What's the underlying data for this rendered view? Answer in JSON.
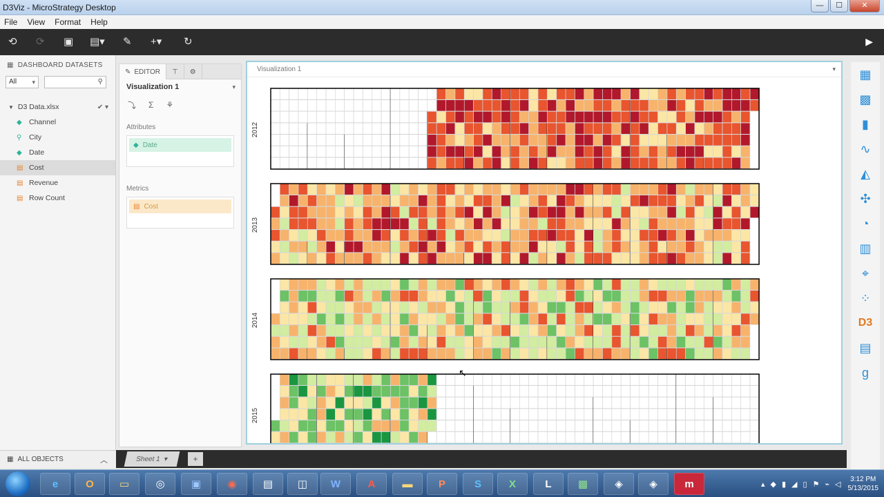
{
  "window": {
    "title": "D3Viz - MicroStrategy Desktop",
    "minimize": "—",
    "maximize": "☐",
    "close": "✕"
  },
  "menu": [
    "File",
    "View",
    "Format",
    "Help"
  ],
  "datasets_panel": {
    "header": "DASHBOARD DATASETS",
    "filter_value": "All",
    "search_placeholder": "",
    "dataset_name": "D3 Data.xlsx",
    "attributes": [
      "Channel",
      "City",
      "Date"
    ],
    "metrics": [
      "Cost",
      "Revenue",
      "Row Count"
    ],
    "selected_item": "Cost",
    "footer": "ALL OBJECTS"
  },
  "editor_panel": {
    "tab_editor": "EDITOR",
    "viz_name": "Visualization 1",
    "attributes_label": "Attributes",
    "attribute_chip": "Date",
    "metrics_label": "Metrics",
    "metric_chip": "Cost"
  },
  "viz_panel": {
    "title": "Visualization 1"
  },
  "sheets": {
    "tab": "Sheet 1",
    "add": "+"
  },
  "taskbar": {
    "time": "3:12 PM",
    "date": "5/13/2015"
  },
  "chart_data": {
    "type": "heatmap",
    "subtype": "calendar",
    "years": [
      "2012",
      "2013",
      "2014",
      "2015"
    ],
    "grid": true,
    "colors": {
      "high": "#b2182b",
      "mid_high": "#e8552f",
      "mid": "#f7b36b",
      "neutral": "#fbe6a5",
      "mid_low": "#d2eca0",
      "low": "#6cc265",
      "lowest": "#1a9641",
      "empty": "#ffffff"
    },
    "year_intensity": {
      "2012": {
        "data_from_month": 5,
        "level": "high"
      },
      "2013": {
        "data_from_month": 1,
        "level": "mid_high"
      },
      "2014": {
        "data_from_month": 1,
        "level": "mid_low"
      },
      "2015": {
        "data_to_month": 4,
        "level": "low"
      }
    }
  }
}
